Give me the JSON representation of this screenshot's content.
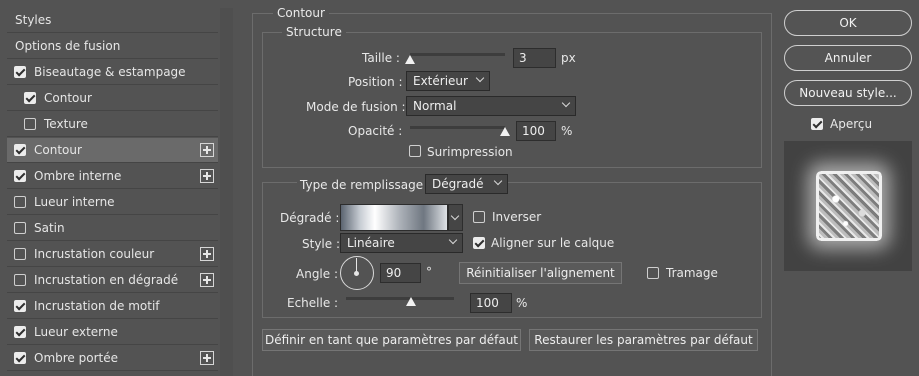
{
  "sidebar": {
    "header": "Styles",
    "blend_options": "Options de fusion",
    "items": [
      {
        "label": "Biseautage & estampage",
        "checked": true,
        "plus": false,
        "indent": false,
        "selected": false
      },
      {
        "label": "Contour",
        "checked": true,
        "plus": false,
        "indent": true,
        "selected": false
      },
      {
        "label": "Texture",
        "checked": false,
        "plus": false,
        "indent": true,
        "selected": false
      },
      {
        "label": "Contour",
        "checked": true,
        "plus": true,
        "indent": false,
        "selected": true
      },
      {
        "label": "Ombre interne",
        "checked": true,
        "plus": true,
        "indent": false,
        "selected": false
      },
      {
        "label": "Lueur interne",
        "checked": false,
        "plus": false,
        "indent": false,
        "selected": false
      },
      {
        "label": "Satin",
        "checked": false,
        "plus": false,
        "indent": false,
        "selected": false
      },
      {
        "label": "Incrustation couleur",
        "checked": false,
        "plus": true,
        "indent": false,
        "selected": false
      },
      {
        "label": "Incrustation en dégradé",
        "checked": false,
        "plus": true,
        "indent": false,
        "selected": false
      },
      {
        "label": "Incrustation de motif",
        "checked": true,
        "plus": false,
        "indent": false,
        "selected": false
      },
      {
        "label": "Lueur externe",
        "checked": true,
        "plus": false,
        "indent": false,
        "selected": false
      },
      {
        "label": "Ombre portée",
        "checked": true,
        "plus": true,
        "indent": false,
        "selected": false
      }
    ]
  },
  "panel": {
    "title": "Contour",
    "structure": {
      "legend": "Structure",
      "size_label": "Taille :",
      "size_value": "3",
      "size_unit": "px",
      "size_slider_fraction": 0.0,
      "position_label": "Position :",
      "position_value": "Extérieur",
      "blend_label": "Mode de fusion :",
      "blend_value": "Normal",
      "opacity_label": "Opacité :",
      "opacity_value": "100",
      "opacity_unit": "%",
      "opacity_slider_fraction": 1.0,
      "overprint_label": "Surimpression",
      "overprint_checked": false
    },
    "fill": {
      "type_label": "Type de remplissage :",
      "type_value": "Dégradé",
      "gradient_label": "Dégradé :",
      "reverse_label": "Inverser",
      "reverse_checked": false,
      "style_label": "Style :",
      "style_value": "Linéaire",
      "align_label": "Aligner sur le calque",
      "align_checked": true,
      "angle_label": "Angle :",
      "angle_value": "90",
      "angle_unit": "°",
      "reset_align": "Réinitialiser l'alignement",
      "dither_label": "Tramage",
      "dither_checked": false,
      "scale_label": "Echelle :",
      "scale_value": "100",
      "scale_unit": "%",
      "scale_slider_fraction": 0.6
    },
    "make_default": "Définir en tant que paramètres par défaut",
    "reset_default": "Restaurer les paramètres par défaut"
  },
  "actions": {
    "ok": "OK",
    "cancel": "Annuler",
    "new_style": "Nouveau style...",
    "preview_label": "Aperçu",
    "preview_checked": true
  }
}
